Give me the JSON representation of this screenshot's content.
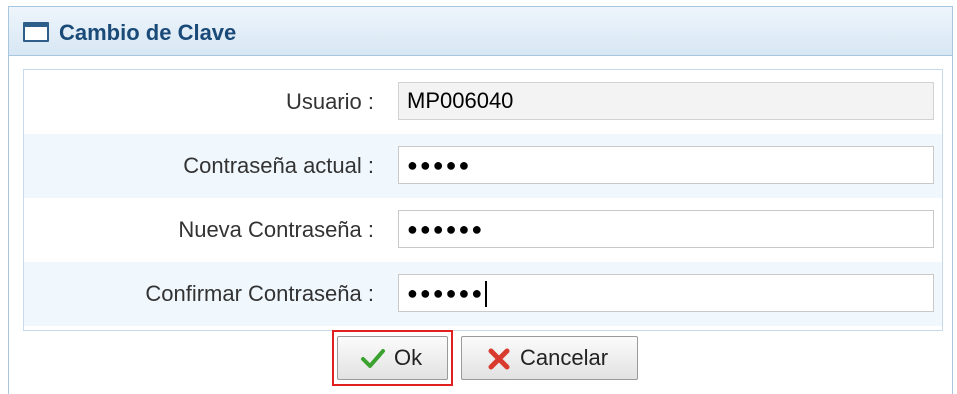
{
  "dialog": {
    "title": "Cambio de Clave",
    "icon": "window-icon"
  },
  "form": {
    "fields": [
      {
        "label": "Usuario :",
        "value": "MP006040",
        "readonly": true
      },
      {
        "label": "Contraseña actual :",
        "value": "●●●●●",
        "type": "password"
      },
      {
        "label": "Nueva Contraseña :",
        "value": "●●●●●●",
        "type": "password"
      },
      {
        "label": "Confirmar Contraseña :",
        "value": "●●●●●●",
        "type": "password",
        "focused": true
      }
    ]
  },
  "buttons": {
    "ok": {
      "label": "Ok",
      "icon": "checkmark-icon",
      "highlighted": true
    },
    "cancel": {
      "label": "Cancelar",
      "icon": "close-x-icon"
    }
  },
  "colors": {
    "title": "#1a4a78",
    "highlight_border": "#e02020",
    "ok_icon": "#3aa22f",
    "cancel_icon": "#d83a2e"
  }
}
